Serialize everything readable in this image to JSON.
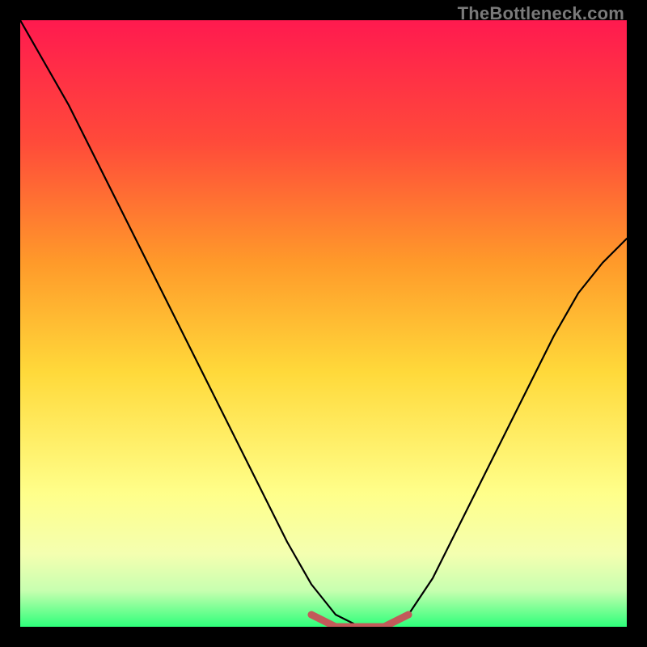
{
  "watermark": "TheBottleneck.com",
  "chart_data": {
    "type": "line",
    "title": "",
    "xlabel": "",
    "ylabel": "",
    "xlim": [
      0,
      100
    ],
    "ylim": [
      0,
      100
    ],
    "grid": false,
    "legend": false,
    "background_gradient": {
      "top": "#ff1a4f",
      "mid_upper": "#ff8a2a",
      "mid": "#ffd93a",
      "mid_lower": "#ffff8a",
      "bottom": "#2eff7a"
    },
    "series": [
      {
        "name": "curve",
        "color": "#000000",
        "x": [
          0,
          4,
          8,
          12,
          16,
          20,
          24,
          28,
          32,
          36,
          40,
          44,
          48,
          52,
          56,
          60,
          64,
          68,
          72,
          76,
          80,
          84,
          88,
          92,
          96,
          100
        ],
        "y": [
          100,
          93,
          86,
          78,
          70,
          62,
          54,
          46,
          38,
          30,
          22,
          14,
          7,
          2,
          0,
          0,
          2,
          8,
          16,
          24,
          32,
          40,
          48,
          55,
          60,
          64
        ]
      },
      {
        "name": "baseline-highlight",
        "color": "#c25a5a",
        "x": [
          48,
          50,
          52,
          54,
          56,
          58,
          60,
          62,
          64
        ],
        "y": [
          2,
          1,
          0,
          0,
          0,
          0,
          0,
          1,
          2
        ]
      }
    ]
  }
}
